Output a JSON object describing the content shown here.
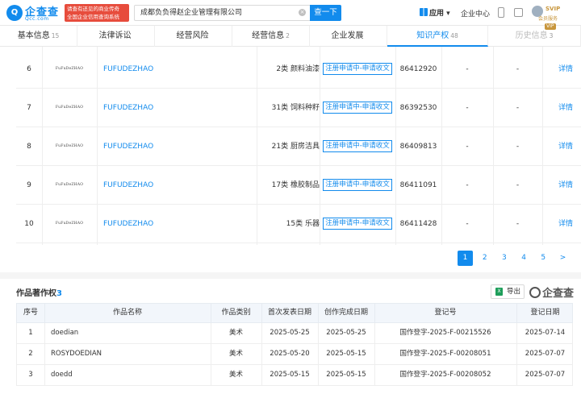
{
  "header": {
    "logo_text": "企查查",
    "logo_sub": "Qcc.com",
    "slogan_line1": "请查有还见的商业传奇",
    "slogan_line2": "全国企业信用查询系统",
    "search_value": "成都负负得赵企业管理有限公司",
    "search_button": "查一下",
    "app_menu": "应用",
    "enterprise_center": "企业中心",
    "svip_label": "SVIP",
    "member_service": "会员服务"
  },
  "tabs": [
    {
      "label": "基本信息",
      "count": "15"
    },
    {
      "label": "法律诉讼",
      "count": ""
    },
    {
      "label": "经营风险",
      "count": ""
    },
    {
      "label": "经营信息",
      "count": "2"
    },
    {
      "label": "企业发展",
      "count": ""
    },
    {
      "label": "知识产权",
      "count": "48"
    },
    {
      "label": "历史信息",
      "count": "3"
    }
  ],
  "vip_tag": "VIP",
  "trademarks": [
    {
      "no": "6",
      "image_text": "FuFuDeZHAO",
      "name": "FUFUDEZHAO",
      "category": "2类 颜料油漆",
      "status": "注册申请中-申请收文",
      "reg_no": "86412920",
      "col7": "-",
      "col8": "-",
      "action": "详情"
    },
    {
      "no": "7",
      "image_text": "FuFuDeZHAO",
      "name": "FUFUDEZHAO",
      "category": "31类 饲料种籽",
      "status": "注册申请中-申请收文",
      "reg_no": "86392530",
      "col7": "-",
      "col8": "-",
      "action": "详情"
    },
    {
      "no": "8",
      "image_text": "FuFuDeZHAO",
      "name": "FUFUDEZHAO",
      "category": "21类 厨房洁具",
      "status": "注册申请中-申请收文",
      "reg_no": "86409813",
      "col7": "-",
      "col8": "-",
      "action": "详情"
    },
    {
      "no": "9",
      "image_text": "FuFuDeZHAO",
      "name": "FUFUDEZHAO",
      "category": "17类 橡胶制品",
      "status": "注册申请中-申请收文",
      "reg_no": "86411091",
      "col7": "-",
      "col8": "-",
      "action": "详情"
    },
    {
      "no": "10",
      "image_text": "FuFuDeZHAO",
      "name": "FUFUDEZHAO",
      "category": "15类 乐器",
      "status": "注册申请中-申请收文",
      "reg_no": "86411428",
      "col7": "-",
      "col8": "-",
      "action": "详情"
    }
  ],
  "pagination": {
    "pages": [
      "1",
      "2",
      "3",
      "4",
      "5"
    ],
    "current": "1",
    "next": ">"
  },
  "copyright": {
    "title": "作品著作权",
    "count": "3",
    "export_label": "导出",
    "brand": "企查查",
    "columns": [
      "序号",
      "作品名称",
      "作品类别",
      "首次发表日期",
      "创作完成日期",
      "登记号",
      "登记日期"
    ],
    "rows": [
      [
        "1",
        "doedian",
        "美术",
        "2025-05-25",
        "2025-05-25",
        "国作登字-2025-F-00215526",
        "2025-07-14"
      ],
      [
        "2",
        "ROSYDOEDIAN",
        "美术",
        "2025-05-20",
        "2025-05-15",
        "国作登字-2025-F-00208051",
        "2025-07-07"
      ],
      [
        "3",
        "doedd",
        "美术",
        "2025-05-15",
        "2025-05-15",
        "国作登字-2025-F-00208052",
        "2025-07-07"
      ]
    ]
  }
}
